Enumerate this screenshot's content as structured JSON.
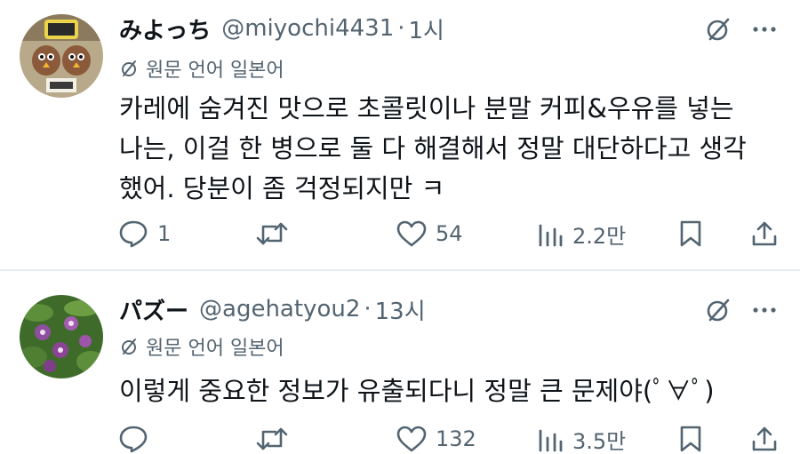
{
  "posts": [
    {
      "display_name": "みよっち",
      "handle": "@miyochi4431",
      "separator": "·",
      "time": "1시",
      "translate_label": "원문 언어 일본어",
      "text_lines": [
        "카레에 숨겨진 맛으로 초콜릿이나 분말 커피&우유를 넣는",
        "나는, 이걸 한 병으로 둘 다 해결해서 정말 대단하다고 생각",
        "했어. 당분이 좀 걱정되지만 ㅋ"
      ],
      "replies": "1",
      "reposts": "",
      "likes": "54",
      "views": "2.2만",
      "avatar_icon": "avatar-plush-toys"
    },
    {
      "display_name": "パズー",
      "handle": "@agehatyou2",
      "separator": "·",
      "time": "13시",
      "translate_label": "원문 언어 일본어",
      "text_lines": [
        "이렇게 중요한 정보가 유출되다니 정말 큰 문제야(ﾟ∀ﾟ)"
      ],
      "replies": "",
      "reposts": "",
      "likes": "132",
      "views": "3.5만",
      "avatar_icon": "avatar-purple-flowers"
    }
  ],
  "colors": {
    "text": "#0f1419",
    "secondary": "#536471",
    "divider": "#e6ecf0"
  },
  "icons": [
    "grok-icon",
    "more-icon",
    "translate-icon",
    "reply-icon",
    "retweet-icon",
    "like-icon",
    "views-icon",
    "bookmark-icon",
    "share-icon"
  ]
}
